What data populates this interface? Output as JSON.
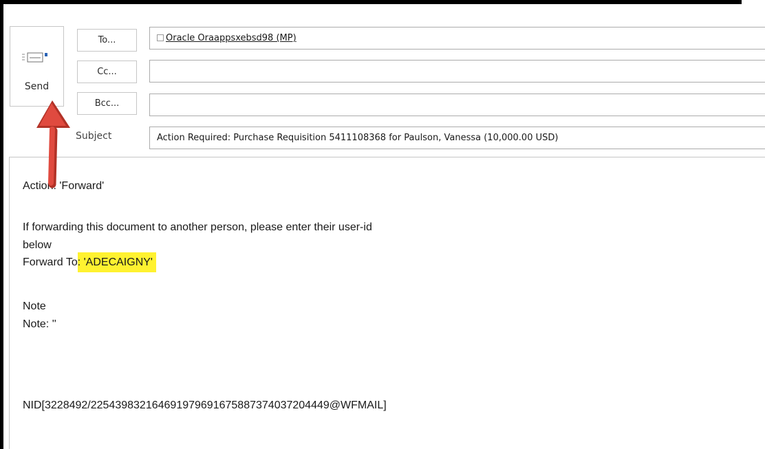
{
  "compose": {
    "send_label": "Send",
    "to_label": "To...",
    "cc_label": "Cc...",
    "bcc_label": "Bcc...",
    "subject_label": "Subject",
    "to_recipient": "Oracle Oraappsxebsd98 (MP)",
    "cc_value": "",
    "bcc_value": "",
    "subject_value": "Action Required: Purchase Requisition 5411108368 for Paulson, Vanessa (10,000.00 USD)"
  },
  "body": {
    "action_line": "Action: 'Forward'",
    "forward_instruction_1": "If forwarding this document to another person, please enter their user-id",
    "forward_instruction_2": "below",
    "forward_to_prefix": "Forward To",
    "forward_to_value": ": 'ADECAIGNY'",
    "note_heading": "Note",
    "note_line": "Note: ''",
    "nid_line": "NID[3228492/225439832164691979691675887374037204449@WFMAIL]"
  },
  "colors": {
    "highlight": "#fff230",
    "arrow": "#e04a3f"
  },
  "icons": [
    "send-icon",
    "checkbox-icon",
    "arrow-annotation-icon"
  ]
}
